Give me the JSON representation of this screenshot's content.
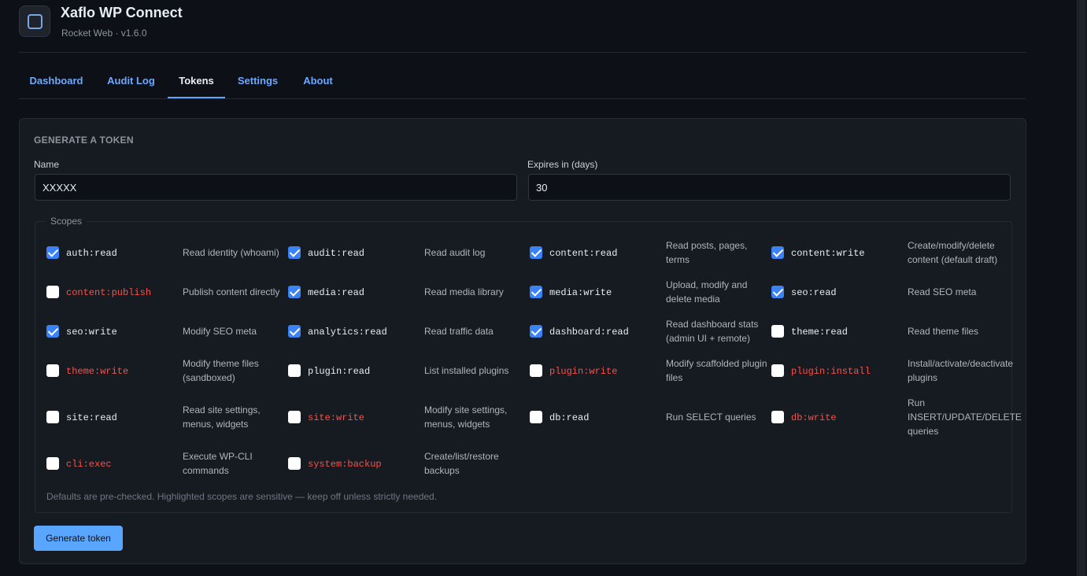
{
  "app": {
    "title": "Xaflo WP Connect",
    "subtitle": "Rocket Web · v1.6.0"
  },
  "tabs": [
    "Dashboard",
    "Audit Log",
    "Tokens",
    "Settings",
    "About"
  ],
  "active_tab": "Tokens",
  "form": {
    "section_title": "GENERATE A TOKEN",
    "name_label": "Name",
    "name_value": "XXXXX",
    "expires_label": "Expires in (days)",
    "expires_value": "30",
    "scopes_legend": "Scopes",
    "hint": "Defaults are pre-checked. Highlighted scopes are sensitive — keep off unless strictly needed.",
    "submit_label": "Generate token"
  },
  "scopes": [
    {
      "name": "auth:read",
      "desc": "Read identity (whoami)",
      "checked": true,
      "sensitive": false
    },
    {
      "name": "audit:read",
      "desc": "Read audit log",
      "checked": true,
      "sensitive": false
    },
    {
      "name": "content:read",
      "desc": "Read posts, pages, terms",
      "checked": true,
      "sensitive": false
    },
    {
      "name": "content:write",
      "desc": "Create/modify/delete content (default draft)",
      "checked": true,
      "sensitive": false
    },
    {
      "name": "content:publish",
      "desc": "Publish content directly",
      "checked": false,
      "sensitive": true
    },
    {
      "name": "media:read",
      "desc": "Read media library",
      "checked": true,
      "sensitive": false
    },
    {
      "name": "media:write",
      "desc": "Upload, modify and delete media",
      "checked": true,
      "sensitive": false
    },
    {
      "name": "seo:read",
      "desc": "Read SEO meta",
      "checked": true,
      "sensitive": false
    },
    {
      "name": "seo:write",
      "desc": "Modify SEO meta",
      "checked": true,
      "sensitive": false
    },
    {
      "name": "analytics:read",
      "desc": "Read traffic data",
      "checked": true,
      "sensitive": false
    },
    {
      "name": "dashboard:read",
      "desc": "Read dashboard stats (admin UI + remote)",
      "checked": true,
      "sensitive": false
    },
    {
      "name": "theme:read",
      "desc": "Read theme files",
      "checked": false,
      "sensitive": false
    },
    {
      "name": "theme:write",
      "desc": "Modify theme files (sandboxed)",
      "checked": false,
      "sensitive": true
    },
    {
      "name": "plugin:read",
      "desc": "List installed plugins",
      "checked": false,
      "sensitive": false
    },
    {
      "name": "plugin:write",
      "desc": "Modify scaffolded plugin files",
      "checked": false,
      "sensitive": true
    },
    {
      "name": "plugin:install",
      "desc": "Install/activate/deactivate plugins",
      "checked": false,
      "sensitive": true
    },
    {
      "name": "site:read",
      "desc": "Read site settings, menus, widgets",
      "checked": false,
      "sensitive": false
    },
    {
      "name": "site:write",
      "desc": "Modify site settings, menus, widgets",
      "checked": false,
      "sensitive": true
    },
    {
      "name": "db:read",
      "desc": "Run SELECT queries",
      "checked": false,
      "sensitive": false
    },
    {
      "name": "db:write",
      "desc": "Run INSERT/UPDATE/DELETE queries",
      "checked": false,
      "sensitive": true
    },
    {
      "name": "cli:exec",
      "desc": "Execute WP-CLI commands",
      "checked": false,
      "sensitive": true
    },
    {
      "name": "system:backup",
      "desc": "Create/list/restore backups",
      "checked": false,
      "sensitive": true
    }
  ]
}
